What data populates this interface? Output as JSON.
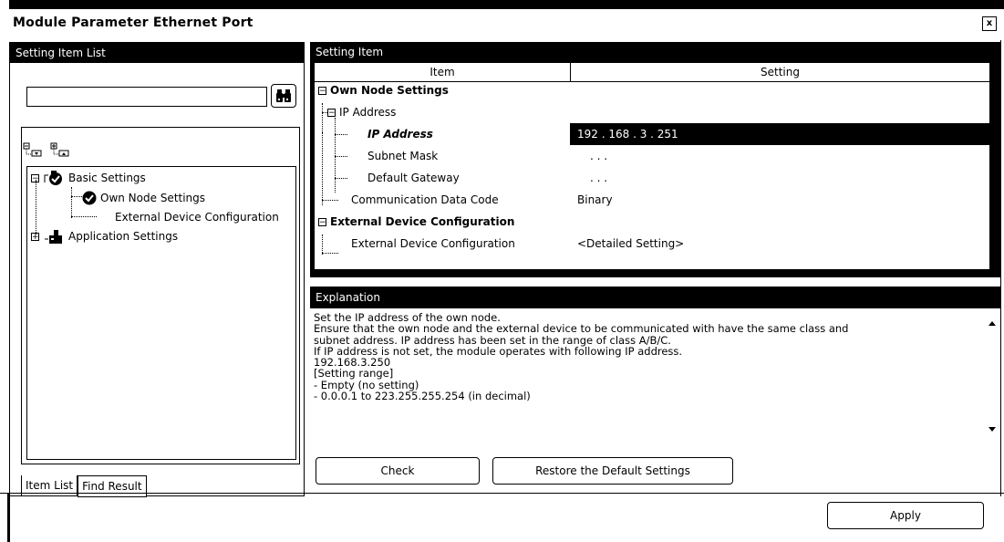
{
  "window": {
    "title": "Module Parameter Ethernet Port",
    "close_label": "x"
  },
  "left_pane": {
    "header": "Setting Item List",
    "search": {
      "value": "",
      "placeholder": ""
    },
    "search_icon": "binoculars-icon",
    "tool_icons": [
      "expand-all-icon",
      "collapse-all-icon"
    ],
    "tree": [
      {
        "label": "Basic Settings",
        "expander": "−",
        "icon": "basic-settings-icon"
      },
      {
        "label": "Own Node Settings",
        "icon": "check-icon"
      },
      {
        "label": "External Device Configuration"
      },
      {
        "label": "Application Settings",
        "expander": "+",
        "icon": "application-settings-icon"
      }
    ],
    "tabs": [
      "Item List",
      "Find Result"
    ]
  },
  "setting_item": {
    "header": "Setting Item",
    "columns": [
      "Item",
      "Setting"
    ],
    "rows": [
      {
        "item": "Own Node Settings",
        "setting": "",
        "expander": "−"
      },
      {
        "item": "IP Address",
        "setting": "",
        "expander": "−"
      },
      {
        "item": "IP Address",
        "setting": "192 . 168 .   3 . 251"
      },
      {
        "item": "Subnet Mask",
        "setting": ".     .     ."
      },
      {
        "item": "Default Gateway",
        "setting": ".     .     ."
      },
      {
        "item": "Communication Data Code",
        "setting": "Binary"
      },
      {
        "item": "External Device Configuration",
        "setting": "",
        "expander": "−"
      },
      {
        "item": "External Device Configuration",
        "setting": "<Detailed Setting>"
      }
    ]
  },
  "explanation": {
    "header": "Explanation",
    "text": "Set the IP address of the own node.\nEnsure that the own node and the external device to be communicated with have the same class and\nsubnet address. IP address has been set in the range of class A/B/C.\nIf IP address is not set, the module operates with following IP address.\n192.168.3.250\n[Setting range]\n- Empty (no setting)\n- 0.0.0.1 to 223.255.255.254 (in decimal)"
  },
  "buttons": {
    "check": "Check",
    "restore": "Restore the Default Settings",
    "apply": "Apply"
  }
}
